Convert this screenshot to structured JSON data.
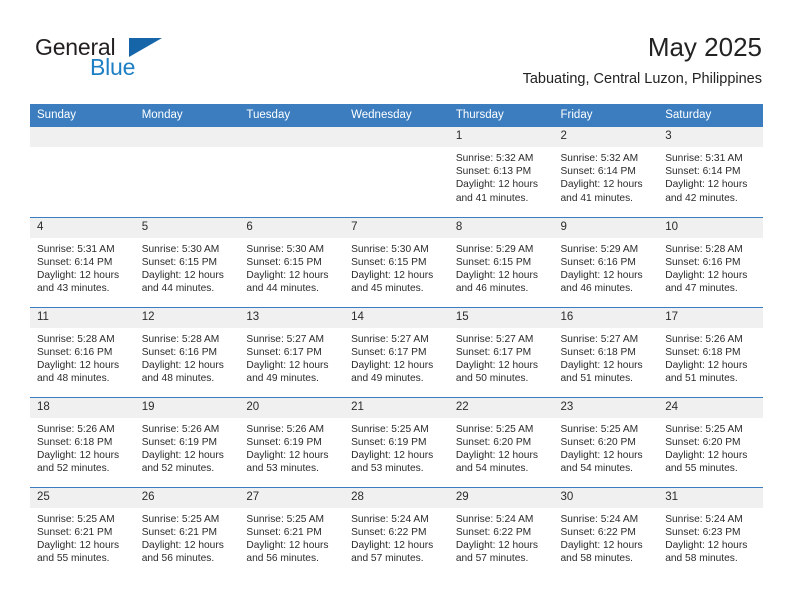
{
  "brand": {
    "name_part1": "General",
    "name_part2": "Blue",
    "flag_icon": "triangle-flag-icon"
  },
  "header": {
    "title": "May 2025",
    "subtitle": "Tabuating, Central Luzon, Philippines"
  },
  "colors": {
    "header_blue": "#3b7dbf",
    "brand_blue": "#1f7fc4",
    "flag_blue": "#1565a8",
    "daynum_band": "#f0f0f0",
    "text": "#2b2b2b"
  },
  "calendar": {
    "weekday_headers": [
      "Sunday",
      "Monday",
      "Tuesday",
      "Wednesday",
      "Thursday",
      "Friday",
      "Saturday"
    ],
    "weeks": [
      [
        {
          "day": "",
          "lines": []
        },
        {
          "day": "",
          "lines": []
        },
        {
          "day": "",
          "lines": []
        },
        {
          "day": "",
          "lines": []
        },
        {
          "day": "1",
          "lines": [
            "Sunrise: 5:32 AM",
            "Sunset: 6:13 PM",
            "Daylight: 12 hours",
            "and 41 minutes."
          ]
        },
        {
          "day": "2",
          "lines": [
            "Sunrise: 5:32 AM",
            "Sunset: 6:14 PM",
            "Daylight: 12 hours",
            "and 41 minutes."
          ]
        },
        {
          "day": "3",
          "lines": [
            "Sunrise: 5:31 AM",
            "Sunset: 6:14 PM",
            "Daylight: 12 hours",
            "and 42 minutes."
          ]
        }
      ],
      [
        {
          "day": "4",
          "lines": [
            "Sunrise: 5:31 AM",
            "Sunset: 6:14 PM",
            "Daylight: 12 hours",
            "and 43 minutes."
          ]
        },
        {
          "day": "5",
          "lines": [
            "Sunrise: 5:30 AM",
            "Sunset: 6:15 PM",
            "Daylight: 12 hours",
            "and 44 minutes."
          ]
        },
        {
          "day": "6",
          "lines": [
            "Sunrise: 5:30 AM",
            "Sunset: 6:15 PM",
            "Daylight: 12 hours",
            "and 44 minutes."
          ]
        },
        {
          "day": "7",
          "lines": [
            "Sunrise: 5:30 AM",
            "Sunset: 6:15 PM",
            "Daylight: 12 hours",
            "and 45 minutes."
          ]
        },
        {
          "day": "8",
          "lines": [
            "Sunrise: 5:29 AM",
            "Sunset: 6:15 PM",
            "Daylight: 12 hours",
            "and 46 minutes."
          ]
        },
        {
          "day": "9",
          "lines": [
            "Sunrise: 5:29 AM",
            "Sunset: 6:16 PM",
            "Daylight: 12 hours",
            "and 46 minutes."
          ]
        },
        {
          "day": "10",
          "lines": [
            "Sunrise: 5:28 AM",
            "Sunset: 6:16 PM",
            "Daylight: 12 hours",
            "and 47 minutes."
          ]
        }
      ],
      [
        {
          "day": "11",
          "lines": [
            "Sunrise: 5:28 AM",
            "Sunset: 6:16 PM",
            "Daylight: 12 hours",
            "and 48 minutes."
          ]
        },
        {
          "day": "12",
          "lines": [
            "Sunrise: 5:28 AM",
            "Sunset: 6:16 PM",
            "Daylight: 12 hours",
            "and 48 minutes."
          ]
        },
        {
          "day": "13",
          "lines": [
            "Sunrise: 5:27 AM",
            "Sunset: 6:17 PM",
            "Daylight: 12 hours",
            "and 49 minutes."
          ]
        },
        {
          "day": "14",
          "lines": [
            "Sunrise: 5:27 AM",
            "Sunset: 6:17 PM",
            "Daylight: 12 hours",
            "and 49 minutes."
          ]
        },
        {
          "day": "15",
          "lines": [
            "Sunrise: 5:27 AM",
            "Sunset: 6:17 PM",
            "Daylight: 12 hours",
            "and 50 minutes."
          ]
        },
        {
          "day": "16",
          "lines": [
            "Sunrise: 5:27 AM",
            "Sunset: 6:18 PM",
            "Daylight: 12 hours",
            "and 51 minutes."
          ]
        },
        {
          "day": "17",
          "lines": [
            "Sunrise: 5:26 AM",
            "Sunset: 6:18 PM",
            "Daylight: 12 hours",
            "and 51 minutes."
          ]
        }
      ],
      [
        {
          "day": "18",
          "lines": [
            "Sunrise: 5:26 AM",
            "Sunset: 6:18 PM",
            "Daylight: 12 hours",
            "and 52 minutes."
          ]
        },
        {
          "day": "19",
          "lines": [
            "Sunrise: 5:26 AM",
            "Sunset: 6:19 PM",
            "Daylight: 12 hours",
            "and 52 minutes."
          ]
        },
        {
          "day": "20",
          "lines": [
            "Sunrise: 5:26 AM",
            "Sunset: 6:19 PM",
            "Daylight: 12 hours",
            "and 53 minutes."
          ]
        },
        {
          "day": "21",
          "lines": [
            "Sunrise: 5:25 AM",
            "Sunset: 6:19 PM",
            "Daylight: 12 hours",
            "and 53 minutes."
          ]
        },
        {
          "day": "22",
          "lines": [
            "Sunrise: 5:25 AM",
            "Sunset: 6:20 PM",
            "Daylight: 12 hours",
            "and 54 minutes."
          ]
        },
        {
          "day": "23",
          "lines": [
            "Sunrise: 5:25 AM",
            "Sunset: 6:20 PM",
            "Daylight: 12 hours",
            "and 54 minutes."
          ]
        },
        {
          "day": "24",
          "lines": [
            "Sunrise: 5:25 AM",
            "Sunset: 6:20 PM",
            "Daylight: 12 hours",
            "and 55 minutes."
          ]
        }
      ],
      [
        {
          "day": "25",
          "lines": [
            "Sunrise: 5:25 AM",
            "Sunset: 6:21 PM",
            "Daylight: 12 hours",
            "and 55 minutes."
          ]
        },
        {
          "day": "26",
          "lines": [
            "Sunrise: 5:25 AM",
            "Sunset: 6:21 PM",
            "Daylight: 12 hours",
            "and 56 minutes."
          ]
        },
        {
          "day": "27",
          "lines": [
            "Sunrise: 5:25 AM",
            "Sunset: 6:21 PM",
            "Daylight: 12 hours",
            "and 56 minutes."
          ]
        },
        {
          "day": "28",
          "lines": [
            "Sunrise: 5:24 AM",
            "Sunset: 6:22 PM",
            "Daylight: 12 hours",
            "and 57 minutes."
          ]
        },
        {
          "day": "29",
          "lines": [
            "Sunrise: 5:24 AM",
            "Sunset: 6:22 PM",
            "Daylight: 12 hours",
            "and 57 minutes."
          ]
        },
        {
          "day": "30",
          "lines": [
            "Sunrise: 5:24 AM",
            "Sunset: 6:22 PM",
            "Daylight: 12 hours",
            "and 58 minutes."
          ]
        },
        {
          "day": "31",
          "lines": [
            "Sunrise: 5:24 AM",
            "Sunset: 6:23 PM",
            "Daylight: 12 hours",
            "and 58 minutes."
          ]
        }
      ]
    ]
  }
}
